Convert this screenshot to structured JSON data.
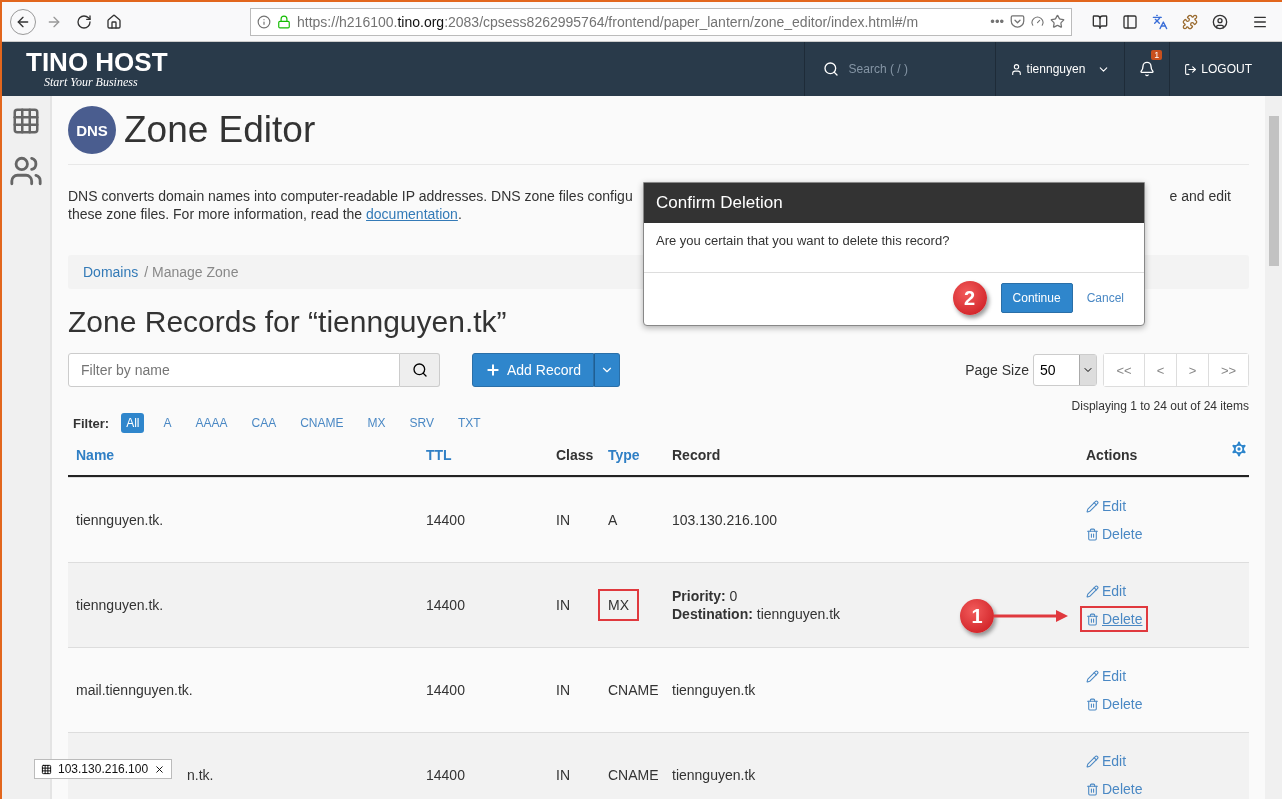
{
  "browser": {
    "url_host": "https://h216100.",
    "url_domain": "tino.org",
    "url_rest": ":2083/cpsess8262995764/frontend/paper_lantern/zone_editor/index.html#/m",
    "more": "•••"
  },
  "header": {
    "logo": "TINO HOST",
    "tagline": "Start Your Business",
    "search_placeholder": "Search ( / )",
    "user": "tiennguyen",
    "notifications": "1",
    "logout": "LOGOUT"
  },
  "page": {
    "title": "Zone Editor",
    "logo_text": "DNS",
    "desc_left": "DNS converts domain names into computer-readable IP addresses. DNS zone files configu",
    "desc_right": "e and edit",
    "desc_line2": "these zone files. For more information, read the ",
    "desc_link": "documentation",
    "desc_end": "."
  },
  "breadcrumb": [
    {
      "label": "Domains",
      "link": true
    },
    {
      "label": "/ Manage Zone",
      "link": false
    }
  ],
  "zone_title": "Zone Records for “tiennguyen.tk”",
  "filter_field": {
    "placeholder": "Filter by name"
  },
  "add_button": "Add Record",
  "page_size": {
    "label": "Page Size",
    "value": "50"
  },
  "pager": [
    "<<",
    "<",
    ">",
    ">>"
  ],
  "displaying": "Displaying 1 to 24 out of 24 items",
  "filter": {
    "label": "Filter:",
    "options": [
      {
        "label": "All",
        "selected": true
      },
      {
        "label": "A",
        "selected": false
      },
      {
        "label": "AAAA",
        "selected": false
      },
      {
        "label": "CAA",
        "selected": false
      },
      {
        "label": "CNAME",
        "selected": false
      },
      {
        "label": "MX",
        "selected": false
      },
      {
        "label": "SRV",
        "selected": false
      },
      {
        "label": "TXT",
        "selected": false
      }
    ]
  },
  "table": {
    "columns": [
      {
        "label": "Name",
        "sortable": true
      },
      {
        "label": "TTL",
        "sortable": true
      },
      {
        "label": "Class",
        "sortable": false
      },
      {
        "label": "Type",
        "sortable": true
      },
      {
        "label": "Record",
        "sortable": false
      },
      {
        "label": "Actions",
        "sortable": false
      }
    ],
    "rows": [
      {
        "name": "tiennguyen.tk.",
        "ttl": "14400",
        "class": "IN",
        "type": "A",
        "type_highlighted": false,
        "record": [
          {
            "text": "103.130.216.100"
          }
        ],
        "edit": "Edit",
        "delete": "Delete",
        "delete_highlighted": false
      },
      {
        "name": "tiennguyen.tk.",
        "ttl": "14400",
        "class": "IN",
        "type": "MX",
        "type_highlighted": true,
        "record": [
          {
            "text": "**Priority:** 0"
          },
          {
            "text": "**Destination:** tiennguyen.tk"
          }
        ],
        "edit": "Edit",
        "delete": "Delete",
        "delete_highlighted": true,
        "annotation": "1"
      },
      {
        "name": "mail.tiennguyen.tk.",
        "ttl": "14400",
        "class": "IN",
        "type": "CNAME",
        "type_highlighted": false,
        "record": [
          {
            "text": "tiennguyen.tk"
          }
        ],
        "edit": "Edit",
        "delete": "Delete",
        "delete_highlighted": false
      },
      {
        "name": "n.tk.",
        "ttl": "14400",
        "class": "IN",
        "type": "CNAME",
        "type_highlighted": false,
        "record": [
          {
            "text": "tiennguyen.tk"
          }
        ],
        "edit": "Edit",
        "delete": "Delete",
        "delete_highlighted": false
      }
    ]
  },
  "dialog": {
    "title": "Confirm Deletion",
    "message": "Are you certain that you want to delete this record?",
    "continue": "Continue",
    "cancel": "Cancel",
    "annotation": "2"
  },
  "status_tooltip": "103.130.216.100"
}
